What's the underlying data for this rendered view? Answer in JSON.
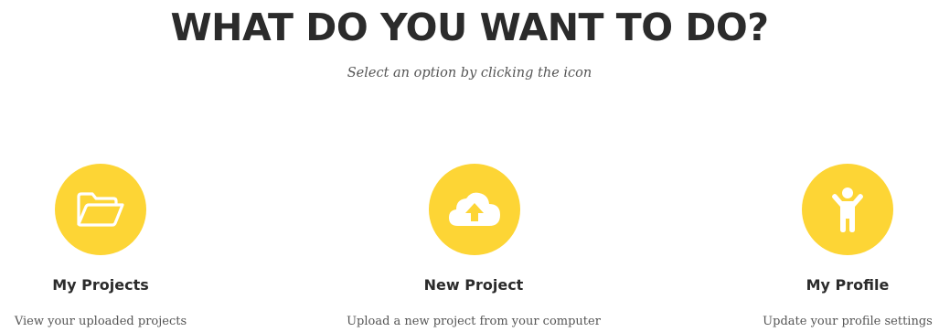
{
  "header": {
    "title": "WHAT DO YOU WANT TO DO?",
    "subtitle": "Select an option by clicking the icon"
  },
  "options": [
    {
      "icon": "folder-open-icon",
      "title": "My Projects",
      "description": "View your uploaded projects"
    },
    {
      "icon": "cloud-upload-icon",
      "title": "New Project",
      "description": "Upload a new project from your computer"
    },
    {
      "icon": "person-icon",
      "title": "My Profile",
      "description": "Update your profile settings"
    }
  ],
  "colors": {
    "accent": "#fdd535",
    "heading": "#2b2b2b",
    "text": "#555555",
    "background": "#ffffff"
  }
}
